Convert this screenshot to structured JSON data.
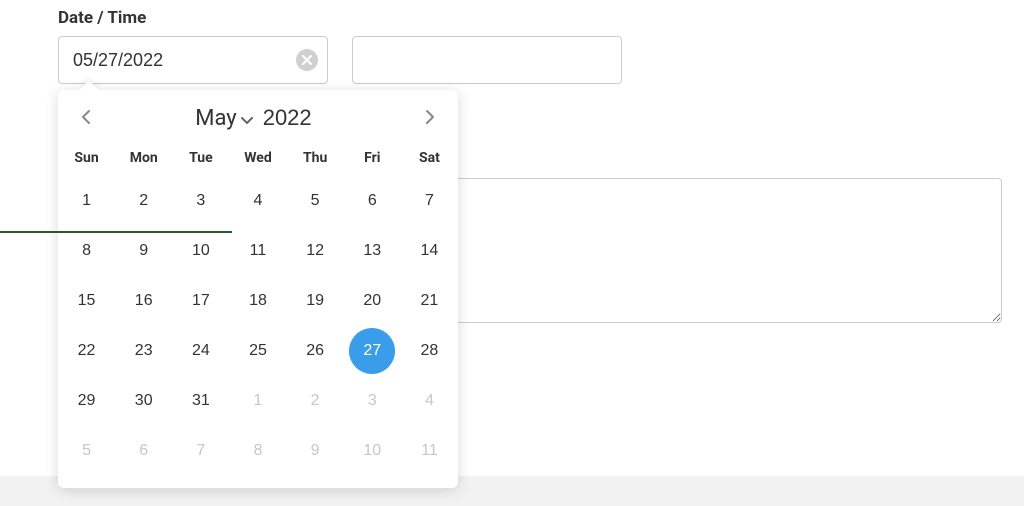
{
  "field_label": "Date / Time",
  "date_input_value": "05/27/2022",
  "time_input_value": "",
  "calendar": {
    "month": "May",
    "year": "2022",
    "weekdays": [
      "Sun",
      "Mon",
      "Tue",
      "Wed",
      "Thu",
      "Fri",
      "Sat"
    ],
    "weeks": [
      [
        {
          "n": 1,
          "other": false,
          "selected": false
        },
        {
          "n": 2,
          "other": false,
          "selected": false
        },
        {
          "n": 3,
          "other": false,
          "selected": false
        },
        {
          "n": 4,
          "other": false,
          "selected": false
        },
        {
          "n": 5,
          "other": false,
          "selected": false
        },
        {
          "n": 6,
          "other": false,
          "selected": false
        },
        {
          "n": 7,
          "other": false,
          "selected": false
        }
      ],
      [
        {
          "n": 8,
          "other": false,
          "selected": false
        },
        {
          "n": 9,
          "other": false,
          "selected": false
        },
        {
          "n": 10,
          "other": false,
          "selected": false
        },
        {
          "n": 11,
          "other": false,
          "selected": false
        },
        {
          "n": 12,
          "other": false,
          "selected": false
        },
        {
          "n": 13,
          "other": false,
          "selected": false
        },
        {
          "n": 14,
          "other": false,
          "selected": false
        }
      ],
      [
        {
          "n": 15,
          "other": false,
          "selected": false
        },
        {
          "n": 16,
          "other": false,
          "selected": false
        },
        {
          "n": 17,
          "other": false,
          "selected": false
        },
        {
          "n": 18,
          "other": false,
          "selected": false
        },
        {
          "n": 19,
          "other": false,
          "selected": false
        },
        {
          "n": 20,
          "other": false,
          "selected": false
        },
        {
          "n": 21,
          "other": false,
          "selected": false
        }
      ],
      [
        {
          "n": 22,
          "other": false,
          "selected": false
        },
        {
          "n": 23,
          "other": false,
          "selected": false
        },
        {
          "n": 24,
          "other": false,
          "selected": false
        },
        {
          "n": 25,
          "other": false,
          "selected": false
        },
        {
          "n": 26,
          "other": false,
          "selected": false
        },
        {
          "n": 27,
          "other": false,
          "selected": true
        },
        {
          "n": 28,
          "other": false,
          "selected": false
        }
      ],
      [
        {
          "n": 29,
          "other": false,
          "selected": false
        },
        {
          "n": 30,
          "other": false,
          "selected": false
        },
        {
          "n": 31,
          "other": false,
          "selected": false
        },
        {
          "n": 1,
          "other": true,
          "selected": false
        },
        {
          "n": 2,
          "other": true,
          "selected": false
        },
        {
          "n": 3,
          "other": true,
          "selected": false
        },
        {
          "n": 4,
          "other": true,
          "selected": false
        }
      ],
      [
        {
          "n": 5,
          "other": true,
          "selected": false
        },
        {
          "n": 6,
          "other": true,
          "selected": false
        },
        {
          "n": 7,
          "other": true,
          "selected": false
        },
        {
          "n": 8,
          "other": true,
          "selected": false
        },
        {
          "n": 9,
          "other": true,
          "selected": false
        },
        {
          "n": 10,
          "other": true,
          "selected": false
        },
        {
          "n": 11,
          "other": true,
          "selected": false
        }
      ]
    ]
  }
}
